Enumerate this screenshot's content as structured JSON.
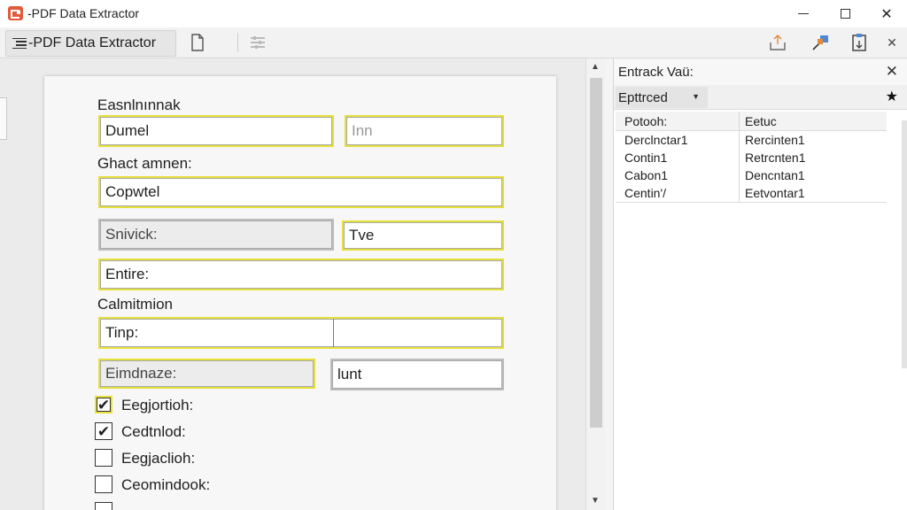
{
  "window": {
    "title": "-PDF Data Extractor",
    "controls": {
      "minimize": "",
      "maximize": "",
      "close": "✕"
    }
  },
  "toolbar": {
    "tab_label": "-PDF Data Extractor",
    "icons": [
      "document-icon",
      "adjust-icon",
      "import-icon",
      "export-icon",
      "clipboard-icon",
      "close-icon"
    ],
    "close_glyph": "✕"
  },
  "form": {
    "section1_label": "Easnlnınnak",
    "field1_value": "Dumel",
    "field2_placeholder": "Inn",
    "section2_label": "Ghact amnen:",
    "field3_value": "Copwtel",
    "field4_value": "Snivick:",
    "field5_value": "Tve",
    "field6_value": "Entire:",
    "section3_label": "Calmitmion",
    "field7_value": "Tinp:",
    "field8_value": "",
    "field9_value": "Eimdnaze:",
    "field10_value": "lunt",
    "checkboxes": [
      {
        "label": "Eegjortioh:",
        "checked": true
      },
      {
        "label": "Cedtnlod:",
        "checked": true
      },
      {
        "label": "Eegjaclioh:",
        "checked": false
      },
      {
        "label": "Ceomindook:",
        "checked": false
      }
    ],
    "check_glyph": "✔"
  },
  "panel": {
    "title": "Entrack Vaü:",
    "close_glyph": "✕",
    "dropdown_value": "Epttrced",
    "caret_glyph": "▼",
    "star_glyph": "★",
    "table": {
      "headers": [
        "Potooh:",
        "Eetuc"
      ],
      "rows": [
        [
          "Derclnctar1",
          "Rercinten1"
        ],
        [
          "Contin1",
          "Retrcnten1"
        ],
        [
          "Cabon1",
          "Dencntan1"
        ],
        [
          "Centin'/",
          "Eetvontar1"
        ]
      ]
    }
  },
  "scrollbar": {
    "up": "▲",
    "down": "▼"
  },
  "colors": {
    "highlight": "#e6e03a",
    "app_icon": "#e15a3b"
  }
}
